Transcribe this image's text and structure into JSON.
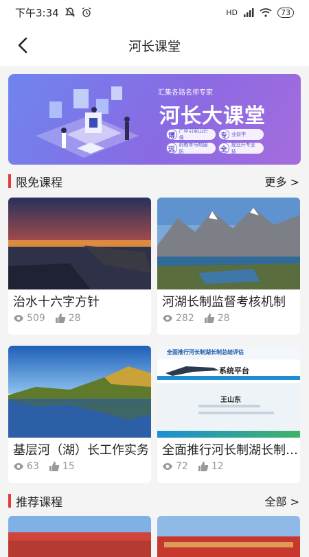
{
  "status_bar": {
    "time": "下午3:34",
    "network": "HD",
    "battery": "73"
  },
  "header": {
    "title": "河长课堂"
  },
  "banner": {
    "subtitle": "汇集各路名师专家",
    "title": "河长大课堂",
    "tags": [
      {
        "key": "博",
        "text": "广中引家山识保"
      },
      {
        "key": "专",
        "text": "业前学"
      },
      {
        "key": "远",
        "text": "前教育与精国防"
      },
      {
        "key": "全",
        "text": "提业升专业技"
      }
    ]
  },
  "free_section": {
    "title": "限免课程",
    "more": "更多 >"
  },
  "free_courses": [
    {
      "title": "治水十六字方针",
      "views": "509",
      "likes": "28"
    },
    {
      "title": "河湖长制监督考核机制",
      "views": "282",
      "likes": "28"
    },
    {
      "title": "基层河（湖）长工作实务",
      "views": "63",
      "likes": "15"
    },
    {
      "title": "全面推行河长制湖长制总结评估",
      "views": "72",
      "likes": "12"
    }
  ],
  "slide": {
    "heading": "全面推行河长制湖长制总结评估",
    "platform": "系统平台",
    "name": "王山东"
  },
  "recommend_section": {
    "title": "推荐课程",
    "more": "全部 >"
  },
  "colors": {
    "accent_bar": "#e53935",
    "banner_start": "#6e85ef",
    "banner_end": "#a46cdd"
  }
}
